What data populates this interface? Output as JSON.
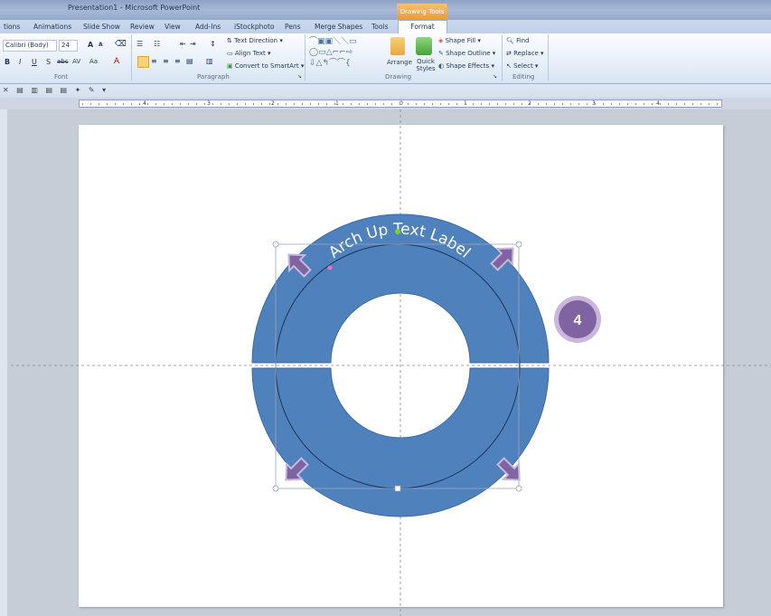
{
  "window": {
    "title": "Presentation1 - Microsoft PowerPoint",
    "context_tab_group": "Drawing Tools"
  },
  "tabs": [
    "tions",
    "Animations",
    "Slide Show",
    "Review",
    "View",
    "Add-Ins",
    "iStockphoto",
    "Pens",
    "Merge Shapes",
    "Tools",
    "Format"
  ],
  "ribbon": {
    "font": {
      "name": "Calibri (Body)",
      "size": "24",
      "label": "Font"
    },
    "paragraph": {
      "label": "Paragraph",
      "text_direction": "Text Direction",
      "align_text": "Align Text",
      "convert_smartart": "Convert to SmartArt"
    },
    "drawing": {
      "label": "Drawing",
      "arrange": "Arrange",
      "quick_styles": "Quick Styles",
      "shape_fill": "Shape Fill",
      "shape_outline": "Shape Outline",
      "shape_effects": "Shape Effects"
    },
    "editing": {
      "label": "Editing",
      "find": "Find",
      "replace": "Replace",
      "select": "Select"
    }
  },
  "ruler": {
    "labels": [
      "4",
      "3",
      "2",
      "1",
      "0",
      "1",
      "2",
      "3",
      "4"
    ]
  },
  "slide": {
    "arch_text": "Arch Up Text Label",
    "badge_number": "4",
    "colors": {
      "ring": "#4f81bd",
      "ring_stroke": "#3a6aa5",
      "arrow": "#8064a2",
      "badge": "#8064a2",
      "badge_ring": "#c9b8dc"
    }
  }
}
